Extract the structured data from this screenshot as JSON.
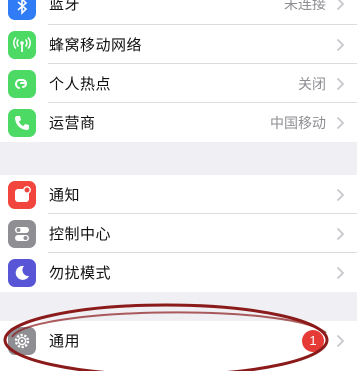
{
  "group1": {
    "bluetooth": {
      "label": "蓝牙",
      "value": "未连接",
      "icon": "bluetooth-icon",
      "color": "#2f7cf6"
    },
    "cellular": {
      "label": "蜂窝移动网络",
      "icon": "antenna-icon",
      "color": "#4cd964"
    },
    "hotspot": {
      "label": "个人热点",
      "value": "关闭",
      "icon": "hotspot-link-icon",
      "color": "#4cd964"
    },
    "carrier": {
      "label": "运营商",
      "value": "中国移动",
      "icon": "phone-icon",
      "color": "#4cd964"
    }
  },
  "group2": {
    "notifications": {
      "label": "通知",
      "icon": "notification-icon",
      "color": "#f2453d"
    },
    "control_center": {
      "label": "控制中心",
      "icon": "toggles-icon",
      "color": "#8e8e93"
    },
    "dnd": {
      "label": "勿扰模式",
      "icon": "moon-icon",
      "color": "#5856d6"
    }
  },
  "group3": {
    "general": {
      "label": "通用",
      "badge": "1",
      "icon": "gear-icon",
      "color": "#8e8e93"
    }
  },
  "annotation": {
    "color": "#8b1a1a"
  }
}
